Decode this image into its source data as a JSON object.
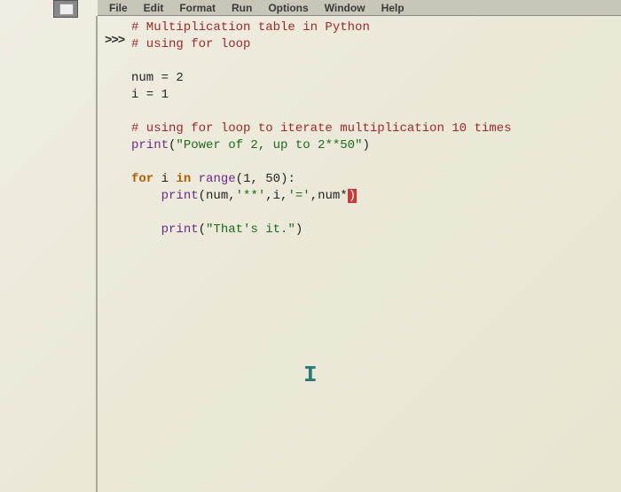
{
  "menu": {
    "items": [
      "File",
      "Edit",
      "Format",
      "Run",
      "Options",
      "Window",
      "Help"
    ]
  },
  "prompt": ">>>",
  "code": {
    "l1_comment": "# Multiplication table in Python",
    "l2_comment": "# using for loop",
    "l4": "num = 2",
    "l5": "i = 1",
    "l7_comment": "# using for loop to iterate multiplication 10 times",
    "l8_print": "print",
    "l8_paren_open": "(",
    "l8_string": "\"Power of 2, up to 2**50\"",
    "l8_paren_close": ")",
    "l10_for": "for",
    "l10_var": " i ",
    "l10_in": "in",
    "l10_space": " ",
    "l10_range": "range",
    "l10_args": "(1, 50):",
    "l11_indent": "    ",
    "l11_print": "print",
    "l11_open": "(num,",
    "l11_str1": "'**'",
    "l11_mid": ",i,",
    "l11_str2": "'='",
    "l11_end": ",num*",
    "l11_error": ")",
    "l13_indent": "    ",
    "l13_print": "print",
    "l13_open": "(",
    "l13_str": "\"That's it.\"",
    "l13_close": ")"
  },
  "cursor_glyph": "I"
}
